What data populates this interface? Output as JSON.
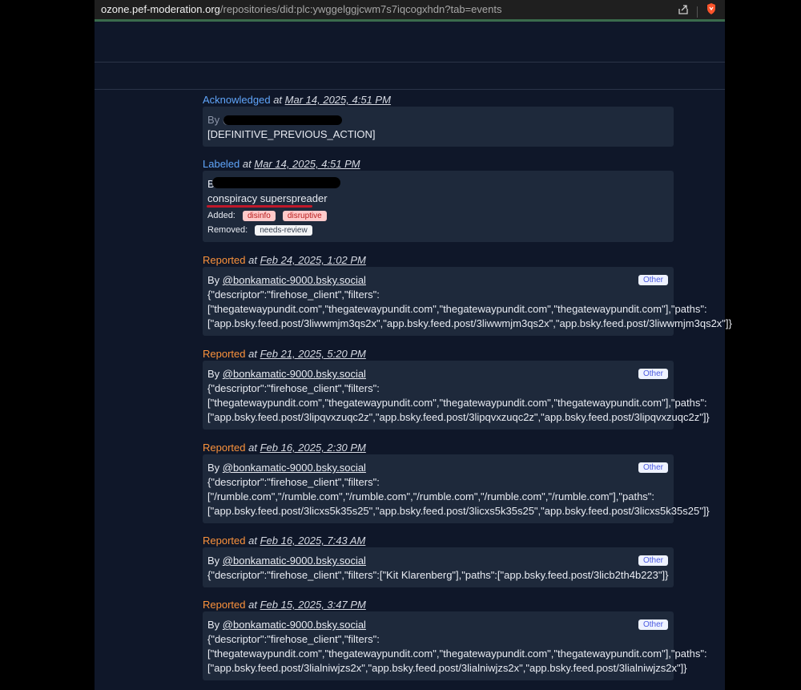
{
  "browser": {
    "url_host": "ozone.pef-moderation.org",
    "url_path": "/repositories/did:plc:ywggelggjcwm7s7iqcogxhdn?tab=events"
  },
  "events": [
    {
      "kind": "Acknowledged",
      "at": "at",
      "time": "Mar 14, 2025, 4:51 PM",
      "by_prefix": "By @",
      "body": "[DEFINITIVE_PREVIOUS_ACTION]"
    },
    {
      "kind": "Labeled",
      "at": "at",
      "time": "Mar 14, 2025, 4:51 PM",
      "by_prefix": "B",
      "body": "conspiracy superspreader",
      "added_label": "Added:",
      "added": [
        "disinfo",
        "disruptive"
      ],
      "removed_label": "Removed:",
      "removed": [
        "needs-review"
      ]
    },
    {
      "kind": "Reported",
      "at": "at",
      "time": "Feb 24, 2025, 1:02 PM",
      "by": "By",
      "handle": "@bonkamatic-9000.bsky.social",
      "badge": "Other",
      "lines": [
        "{\"descriptor\":\"firehose_client\",\"filters\":",
        "[\"thegatewaypundit.com\",\"thegatewaypundit.com\",\"thegatewaypundit.com\",\"thegatewaypundit.com\"],\"paths\":",
        "[\"app.bsky.feed.post/3liwwmjm3qs2x\",\"app.bsky.feed.post/3liwwmjm3qs2x\",\"app.bsky.feed.post/3liwwmjm3qs2x\"]}"
      ]
    },
    {
      "kind": "Reported",
      "at": "at",
      "time": "Feb 21, 2025, 5:20 PM",
      "by": "By",
      "handle": "@bonkamatic-9000.bsky.social",
      "badge": "Other",
      "lines": [
        "{\"descriptor\":\"firehose_client\",\"filters\":",
        "[\"thegatewaypundit.com\",\"thegatewaypundit.com\",\"thegatewaypundit.com\",\"thegatewaypundit.com\"],\"paths\":",
        "[\"app.bsky.feed.post/3lipqvxzuqc2z\",\"app.bsky.feed.post/3lipqvxzuqc2z\",\"app.bsky.feed.post/3lipqvxzuqc2z\"]}"
      ]
    },
    {
      "kind": "Reported",
      "at": "at",
      "time": "Feb 16, 2025, 2:30 PM",
      "by": "By",
      "handle": "@bonkamatic-9000.bsky.social",
      "badge": "Other",
      "lines": [
        "{\"descriptor\":\"firehose_client\",\"filters\":",
        "[\"/rumble.com\",\"/rumble.com\",\"/rumble.com\",\"/rumble.com\",\"/rumble.com\",\"/rumble.com\"],\"paths\":",
        "[\"app.bsky.feed.post/3licxs5k35s25\",\"app.bsky.feed.post/3licxs5k35s25\",\"app.bsky.feed.post/3licxs5k35s25\"]}"
      ]
    },
    {
      "kind": "Reported",
      "at": "at",
      "time": "Feb 16, 2025, 7:43 AM",
      "by": "By",
      "handle": "@bonkamatic-9000.bsky.social",
      "badge": "Other",
      "lines": [
        "{\"descriptor\":\"firehose_client\",\"filters\":[\"Kit Klarenberg\"],\"paths\":[\"app.bsky.feed.post/3licb2th4b223\"]}"
      ]
    },
    {
      "kind": "Reported",
      "at": "at",
      "time": "Feb 15, 2025, 3:47 PM",
      "by": "By",
      "handle": "@bonkamatic-9000.bsky.social",
      "badge": "Other",
      "lines": [
        "{\"descriptor\":\"firehose_client\",\"filters\":",
        "[\"thegatewaypundit.com\",\"thegatewaypundit.com\",\"thegatewaypundit.com\",\"thegatewaypundit.com\"],\"paths\":",
        "[\"app.bsky.feed.post/3lialniwjzs2x\",\"app.bsky.feed.post/3lialniwjzs2x\",\"app.bsky.feed.post/3lialniwjzs2x\"]}"
      ]
    }
  ]
}
